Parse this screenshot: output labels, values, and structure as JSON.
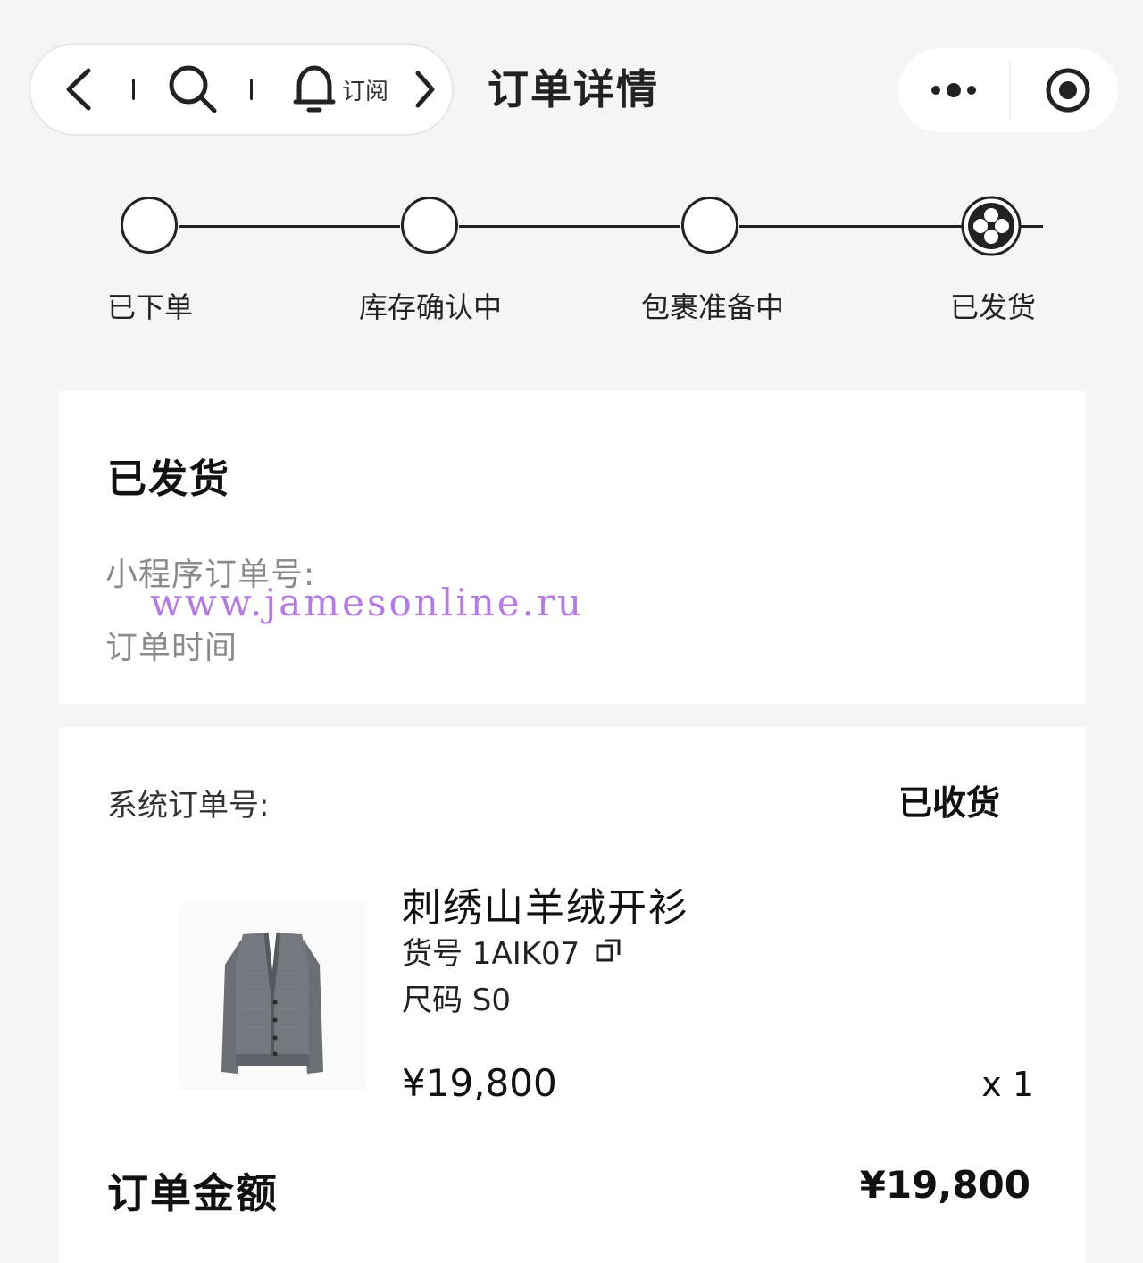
{
  "header": {
    "title": "订单详情",
    "subscribe_label": "订阅",
    "icons": [
      "back-icon",
      "search-icon",
      "bell-icon",
      "forward-icon",
      "more-icon",
      "record-icon"
    ]
  },
  "steps": [
    {
      "label": "已下单",
      "done": false
    },
    {
      "label": "库存确认中",
      "done": false
    },
    {
      "label": "包裹准备中",
      "done": false
    },
    {
      "label": "已发货",
      "done": true
    }
  ],
  "status": {
    "title": "已发货",
    "mini_order_label": "小程序订单号:",
    "order_time_label": "订单时间",
    "watermark": "www.jamesonline.ru"
  },
  "order": {
    "system_order_label": "系统订单号:",
    "state": "已收货",
    "product": {
      "name": "刺绣山羊绒开衫",
      "sku": "货号 1AIK07",
      "size": "尺码 S0",
      "price": "¥19,800",
      "qty": "x 1"
    },
    "total_label": "订单金额",
    "total_value": "¥19,800"
  },
  "colors": {
    "accent": "#222222",
    "background": "#f5f5f5",
    "watermark": "#b47be0"
  }
}
